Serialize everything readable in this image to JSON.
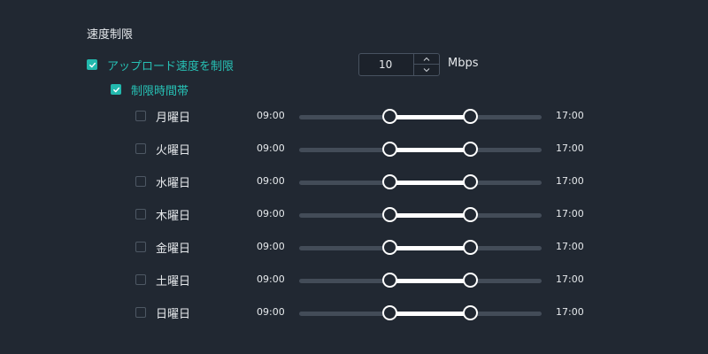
{
  "section": {
    "title": "速度制限"
  },
  "upload_limit": {
    "label": "アップロード速度を制限",
    "checked": true,
    "value": "10",
    "unit": "Mbps"
  },
  "schedule": {
    "label": "制限時間帯",
    "checked": true,
    "days": [
      {
        "label": "月曜日",
        "checked": false,
        "start": "09:00",
        "end": "17:00",
        "start_frac": 0.375,
        "end_frac": 0.708
      },
      {
        "label": "火曜日",
        "checked": false,
        "start": "09:00",
        "end": "17:00",
        "start_frac": 0.375,
        "end_frac": 0.708
      },
      {
        "label": "水曜日",
        "checked": false,
        "start": "09:00",
        "end": "17:00",
        "start_frac": 0.375,
        "end_frac": 0.708
      },
      {
        "label": "木曜日",
        "checked": false,
        "start": "09:00",
        "end": "17:00",
        "start_frac": 0.375,
        "end_frac": 0.708
      },
      {
        "label": "金曜日",
        "checked": false,
        "start": "09:00",
        "end": "17:00",
        "start_frac": 0.375,
        "end_frac": 0.708
      },
      {
        "label": "土曜日",
        "checked": false,
        "start": "09:00",
        "end": "17:00",
        "start_frac": 0.375,
        "end_frac": 0.708
      },
      {
        "label": "日曜日",
        "checked": false,
        "start": "09:00",
        "end": "17:00",
        "start_frac": 0.375,
        "end_frac": 0.708
      }
    ]
  },
  "colors": {
    "background": "#212832",
    "accent": "#22b8ad",
    "track": "#434c58",
    "track_fill": "#ffffff"
  },
  "icons": {
    "checkbox_checked": "checkmark-icon",
    "spin_up": "chevron-up-icon",
    "spin_down": "chevron-down-icon"
  }
}
